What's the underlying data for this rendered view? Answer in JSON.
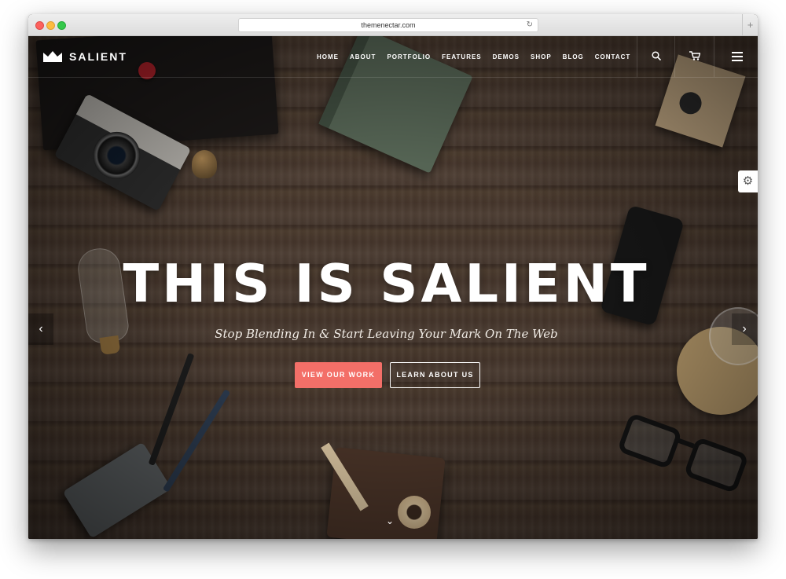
{
  "browser": {
    "url": "themenectar.com",
    "reload_glyph": "↻",
    "new_tab_glyph": "+"
  },
  "header": {
    "logo_text": "SALIENT",
    "menu": [
      "HOME",
      "ABOUT",
      "PORTFOLIO",
      "FEATURES",
      "DEMOS",
      "SHOP",
      "BLOG",
      "CONTACT"
    ],
    "search_icon": "⌕",
    "cart_icon": "🛒"
  },
  "hero": {
    "title": "THIS IS SALIENT",
    "subtitle": "Stop Blending In & Start Leaving Your Mark On The Web",
    "primary_button": "VIEW OUR WORK",
    "secondary_button": "LEARN ABOUT US",
    "prev_arrow": "‹",
    "next_arrow": "›",
    "scroll_glyph": "⌄"
  },
  "settings": {
    "gear_glyph": "⚙"
  },
  "colors": {
    "accent": "#f36f68",
    "nav_text": "#ffffff",
    "chrome_bg": "#e4e4e4"
  }
}
